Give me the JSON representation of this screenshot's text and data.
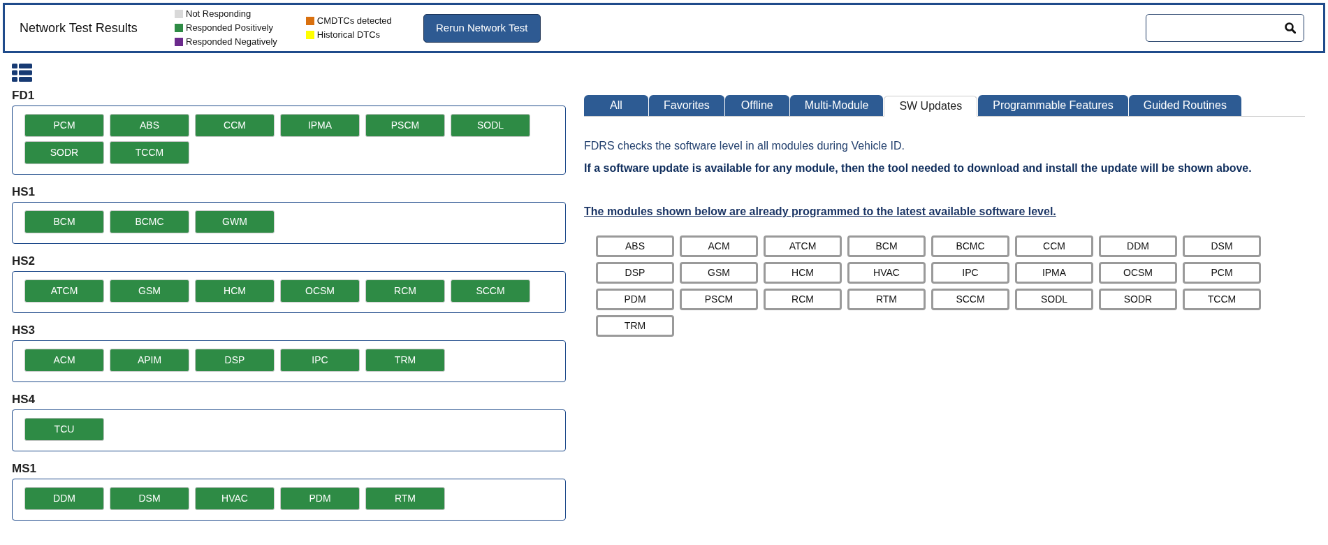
{
  "header": {
    "title": "Network Test Results",
    "legend_columns": [
      [
        {
          "label": "Not Responding",
          "color": "#d9d9d9"
        },
        {
          "label": "Responded Positively",
          "color": "#2e8b45"
        },
        {
          "label": "Responded Negatively",
          "color": "#6b2a8c"
        }
      ],
      [
        {
          "label": "CMDTCs detected",
          "color": "#d9700f"
        },
        {
          "label": "Historical DTCs",
          "color": "#ffff00"
        }
      ]
    ],
    "rerun_button": "Rerun Network Test"
  },
  "networks": [
    {
      "name": "FD1",
      "modules": [
        {
          "label": "PCM",
          "color": "#2e8b45"
        },
        {
          "label": "ABS",
          "color": "#2e8b45"
        },
        {
          "label": "CCM",
          "color": "#2e8b45"
        },
        {
          "label": "IPMA",
          "color": "#2e8b45"
        },
        {
          "label": "PSCM",
          "color": "#2e8b45"
        },
        {
          "label": "SODL",
          "color": "#2e8b45"
        },
        {
          "label": "SODR",
          "color": "#2e8b45"
        },
        {
          "label": "TCCM",
          "color": "#2e8b45"
        }
      ]
    },
    {
      "name": "HS1",
      "modules": [
        {
          "label": "BCM",
          "color": "#2e8b45"
        },
        {
          "label": "BCMC",
          "color": "#2e8b45"
        },
        {
          "label": "GWM",
          "color": "#2e8b45"
        }
      ]
    },
    {
      "name": "HS2",
      "modules": [
        {
          "label": "ATCM",
          "color": "#2e8b45"
        },
        {
          "label": "GSM",
          "color": "#2e8b45"
        },
        {
          "label": "HCM",
          "color": "#2e8b45"
        },
        {
          "label": "OCSM",
          "color": "#2e8b45"
        },
        {
          "label": "RCM",
          "color": "#2e8b45"
        },
        {
          "label": "SCCM",
          "color": "#2e8b45"
        }
      ]
    },
    {
      "name": "HS3",
      "modules": [
        {
          "label": "ACM",
          "color": "#2e8b45"
        },
        {
          "label": "APIM",
          "color": "#2e8b45"
        },
        {
          "label": "DSP",
          "color": "#2e8b45"
        },
        {
          "label": "IPC",
          "color": "#2e8b45"
        },
        {
          "label": "TRM",
          "color": "#2e8b45"
        }
      ]
    },
    {
      "name": "HS4",
      "modules": [
        {
          "label": "TCU",
          "color": "#2e8b45"
        }
      ]
    },
    {
      "name": "MS1",
      "modules": [
        {
          "label": "DDM",
          "color": "#2e8b45"
        },
        {
          "label": "DSM",
          "color": "#2e8b45"
        },
        {
          "label": "HVAC",
          "color": "#2e8b45"
        },
        {
          "label": "PDM",
          "color": "#2e8b45"
        },
        {
          "label": "RTM",
          "color": "#2e8b45"
        }
      ]
    }
  ],
  "tabs": [
    {
      "label": "All",
      "selected": false
    },
    {
      "label": "Favorites",
      "selected": false
    },
    {
      "label": "Offline",
      "selected": false
    },
    {
      "label": "Multi-Module",
      "selected": false
    },
    {
      "label": "SW Updates",
      "selected": true
    },
    {
      "label": "Programmable Features",
      "selected": false
    },
    {
      "label": "Guided Routines",
      "selected": false
    }
  ],
  "sw_updates": {
    "info": "FDRS checks the software level in all modules during Vehicle ID.",
    "notice": "If a software update is available for any module, then the tool needed to download and install the update will be shown above.",
    "up_to_date_heading": "The modules shown below are already programmed to the latest available software level.",
    "modules": [
      "ABS",
      "ACM",
      "ATCM",
      "BCM",
      "BCMC",
      "CCM",
      "DDM",
      "DSM",
      "DSP",
      "GSM",
      "HCM",
      "HVAC",
      "IPC",
      "IPMA",
      "OCSM",
      "PCM",
      "PDM",
      "PSCM",
      "RCM",
      "RTM",
      "SCCM",
      "SODL",
      "SODR",
      "TCCM",
      "TRM"
    ]
  }
}
